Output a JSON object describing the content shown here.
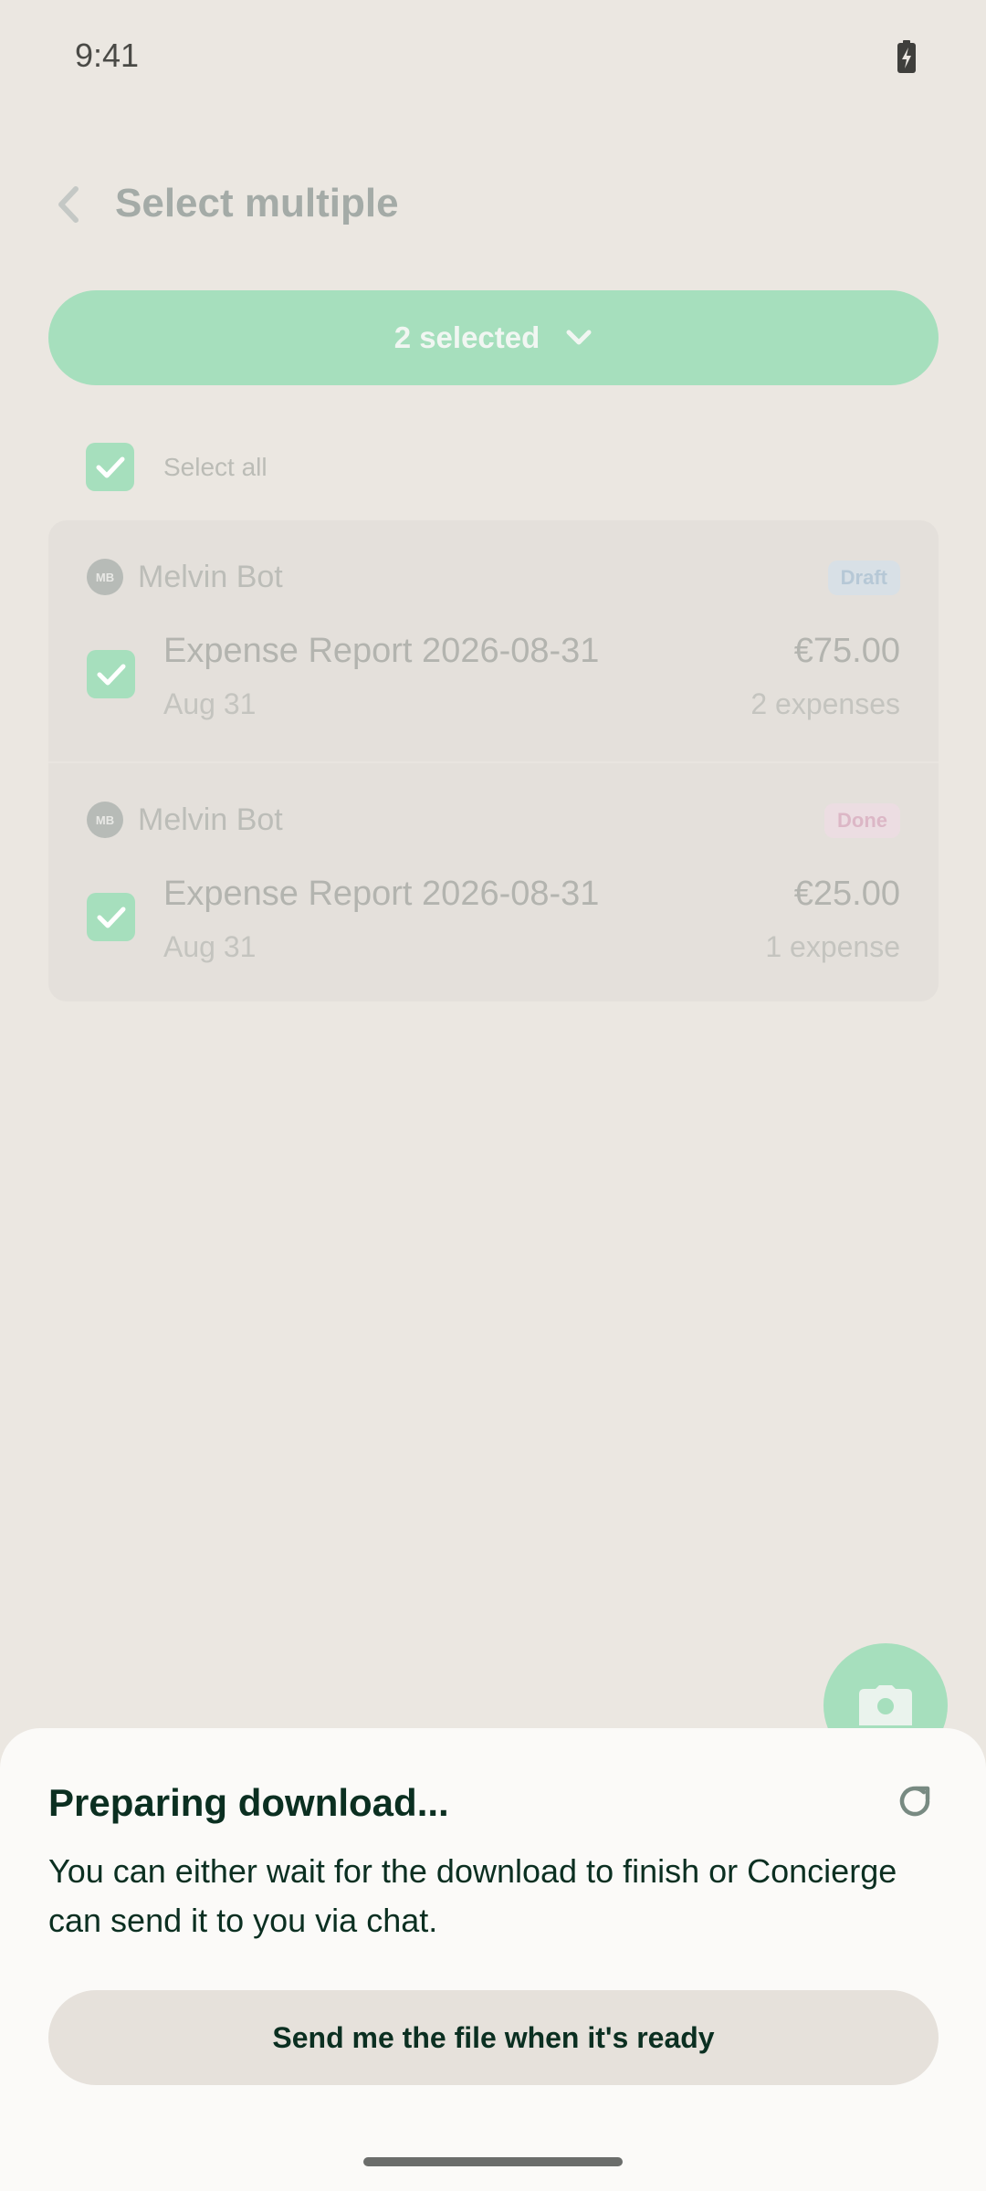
{
  "status_bar": {
    "time": "9:41",
    "battery_icon": "battery-charging-icon"
  },
  "header": {
    "title": "Select multiple",
    "back_icon": "chevron-left-icon"
  },
  "selection": {
    "label": "2 selected",
    "icon": "chevron-down-icon"
  },
  "select_all": {
    "label": "Select all",
    "checked": true
  },
  "reports": [
    {
      "avatar": "MB",
      "submitter": "Melvin Bot",
      "status": "Draft",
      "title": "Expense Report 2026-08-31",
      "date": "Aug 31",
      "amount": "€75.00",
      "count": "2 expenses",
      "checked": true
    },
    {
      "avatar": "MB",
      "submitter": "Melvin Bot",
      "status": "Done",
      "title": "Expense Report 2026-08-31",
      "date": "Aug 31",
      "amount": "€25.00",
      "count": "1 expense",
      "checked": true
    }
  ],
  "fab": {
    "icon": "camera-icon"
  },
  "sheet": {
    "title": "Preparing download...",
    "body": "You can either wait for the download to finish or Concierge can send it to you via chat.",
    "button": "Send me the file when it's ready",
    "refresh_icon": "refresh-icon"
  },
  "colors": {
    "accent": "#a6dfbd",
    "text_dark": "#0b2f21",
    "background": "#ebe7e1",
    "sheet": "#fbfaf8"
  }
}
